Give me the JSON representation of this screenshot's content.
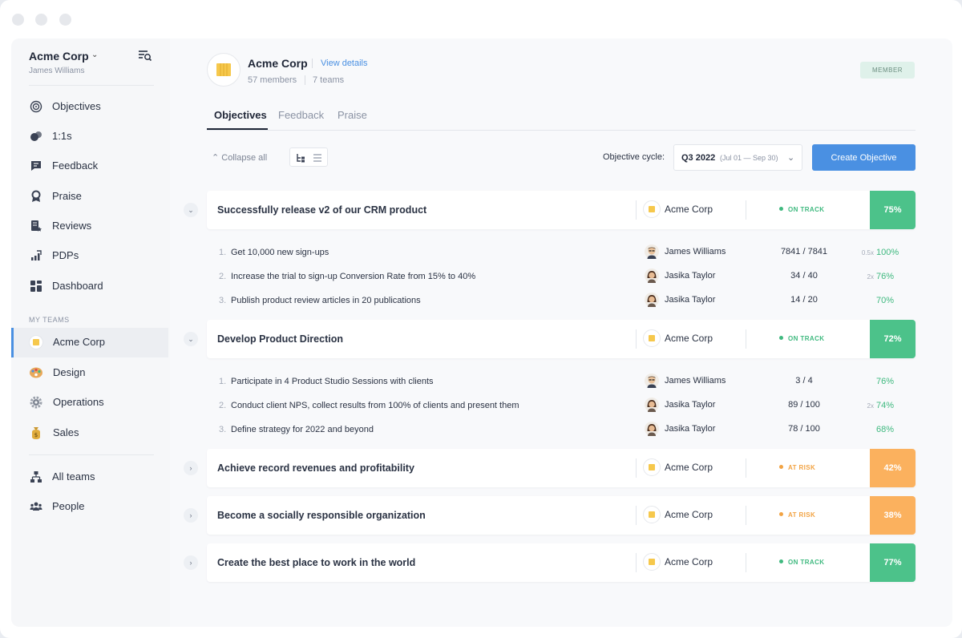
{
  "sidebar": {
    "org_name": "Acme Corp",
    "user_name": "James Williams",
    "nav": [
      {
        "label": "Objectives",
        "icon": "target-icon"
      },
      {
        "label": "1:1s",
        "icon": "chat-bubbles-icon"
      },
      {
        "label": "Feedback",
        "icon": "feedback-icon"
      },
      {
        "label": "Praise",
        "icon": "award-icon"
      },
      {
        "label": "Reviews",
        "icon": "review-icon"
      },
      {
        "label": "PDPs",
        "icon": "growth-chart-icon"
      },
      {
        "label": "Dashboard",
        "icon": "dashboard-icon"
      }
    ],
    "my_teams_label": "MY TEAMS",
    "teams": [
      {
        "label": "Acme Corp",
        "icon": "acme-logo-icon",
        "active": true
      },
      {
        "label": "Design",
        "icon": "palette-icon"
      },
      {
        "label": "Operations",
        "icon": "cog-icon"
      },
      {
        "label": "Sales",
        "icon": "money-bag-icon"
      }
    ],
    "footer": [
      {
        "label": "All teams",
        "icon": "org-chart-icon"
      },
      {
        "label": "People",
        "icon": "people-icon"
      }
    ]
  },
  "header": {
    "title": "Acme Corp",
    "view_details": "View details",
    "members": "57 members",
    "teams": "7 teams",
    "badge": "MEMBER"
  },
  "tabs": [
    "Objectives",
    "Feedback",
    "Praise"
  ],
  "toolbar": {
    "collapse_label": "Collapse all",
    "cycle_label": "Objective cycle:",
    "cycle_value": "Q3 2022",
    "cycle_dates": "(Jul 01 — Sep 30)",
    "create_label": "Create Objective"
  },
  "colors": {
    "accent": "#4a90e2",
    "on_track": "#3fb97f",
    "at_risk": "#fbb15e"
  },
  "objectives": [
    {
      "title": "Successfully release v2 of our CRM product",
      "owner": "Acme Corp",
      "status": "ON TRACK",
      "percent": "75%",
      "expanded": true,
      "key_results": [
        {
          "num": "1.",
          "text": "Get 10,000 new sign-ups",
          "owner": "James Williams",
          "progress": "7841 / 7841",
          "mult": "0.5x",
          "percent": "100%"
        },
        {
          "num": "2.",
          "text": "Increase the trial to sign-up Conversion Rate from 15% to 40%",
          "owner": "Jasika Taylor",
          "progress": "34 / 40",
          "mult": "2x",
          "percent": "76%"
        },
        {
          "num": "3.",
          "text": "Publish product review articles in 20 publications",
          "owner": "Jasika Taylor",
          "progress": "14 / 20",
          "mult": "",
          "percent": "70%"
        }
      ]
    },
    {
      "title": "Develop Product Direction",
      "owner": "Acme Corp",
      "status": "ON TRACK",
      "percent": "72%",
      "expanded": true,
      "key_results": [
        {
          "num": "1.",
          "text": "Participate in 4 Product Studio Sessions with clients",
          "owner": "James Williams",
          "progress": "3 / 4",
          "mult": "",
          "percent": "76%"
        },
        {
          "num": "2.",
          "text": "Conduct client NPS, collect results from 100% of clients and present them",
          "owner": "Jasika Taylor",
          "progress": "89 / 100",
          "mult": "2x",
          "percent": "74%"
        },
        {
          "num": "3.",
          "text": "Define strategy for 2022 and beyond",
          "owner": "Jasika Taylor",
          "progress": "78 / 100",
          "mult": "",
          "percent": "68%"
        }
      ]
    },
    {
      "title": "Achieve record revenues and profitability",
      "owner": "Acme Corp",
      "status": "AT RISK",
      "percent": "42%",
      "expanded": false
    },
    {
      "title": "Become a socially responsible organization",
      "owner": "Acme Corp",
      "status": "AT RISK",
      "percent": "38%",
      "expanded": false
    },
    {
      "title": "Create the best place to work in the world",
      "owner": "Acme Corp",
      "status": "ON TRACK",
      "percent": "77%",
      "expanded": false
    }
  ]
}
